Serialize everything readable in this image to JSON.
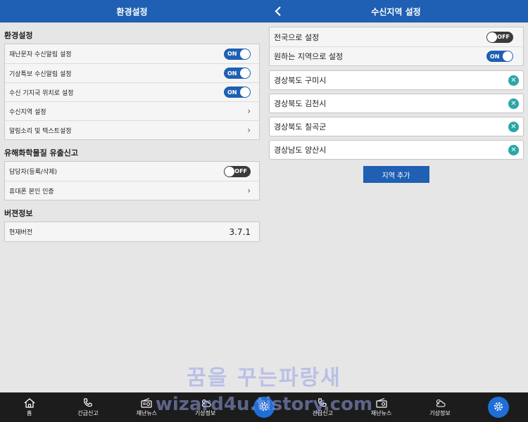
{
  "left": {
    "title": "환경설정",
    "sections": [
      {
        "title": "환경설정",
        "rows": [
          {
            "label": "재난문자 수신알림 설정",
            "control": "toggle",
            "state": "ON"
          },
          {
            "label": "기상특보 수신알림 설정",
            "control": "toggle",
            "state": "ON"
          },
          {
            "label": "수신 기지국 위치로 설정",
            "control": "toggle",
            "state": "ON"
          },
          {
            "label": "수신지역 설정",
            "control": "chevron"
          },
          {
            "label": "알림소리 및 텍스트설정",
            "control": "chevron"
          }
        ]
      },
      {
        "title": "유해화학물질 유출신고",
        "rows": [
          {
            "label": "담당자(등록/삭제)",
            "control": "toggle",
            "state": "OFF"
          },
          {
            "label": "휴대폰 본인 인증",
            "control": "chevron"
          }
        ]
      },
      {
        "title": "버젼정보",
        "rows": [
          {
            "label": "현재버전",
            "control": "value",
            "value": "3.7.1"
          }
        ]
      }
    ]
  },
  "right": {
    "title": "수신지역 설정",
    "options": [
      {
        "label": "전국으로 설정",
        "state": "OFF"
      },
      {
        "label": "원하는 지역으로 설정",
        "state": "ON"
      }
    ],
    "regions": [
      "경상북도 구미시",
      "경상북도 김천시",
      "경상북도 칠곡군",
      "경상남도 양산시"
    ],
    "add_label": "지역 추가"
  },
  "nav": [
    {
      "label": "홈",
      "icon": "home-icon"
    },
    {
      "label": "긴급신고",
      "icon": "phone-icon"
    },
    {
      "label": "재난뉴스",
      "icon": "radio-icon"
    },
    {
      "label": "기상정보",
      "icon": "weather-icon"
    },
    {
      "label": "",
      "icon": "gear-icon"
    },
    {
      "label": "긴급신고",
      "icon": "phone-icon"
    },
    {
      "label": "재난뉴스",
      "icon": "radio-icon"
    },
    {
      "label": "기상정보",
      "icon": "weather-icon"
    },
    {
      "label": "",
      "icon": "gear-icon"
    }
  ],
  "watermark": {
    "line1": "꿈을 꾸는파랑새",
    "line2": "wizard4u.tistory.com"
  },
  "colors": {
    "header": "#1f5fb4",
    "toggle_on": "#1f5fb4",
    "toggle_off": "#3a3a3a",
    "delete": "#2aa6a6"
  }
}
